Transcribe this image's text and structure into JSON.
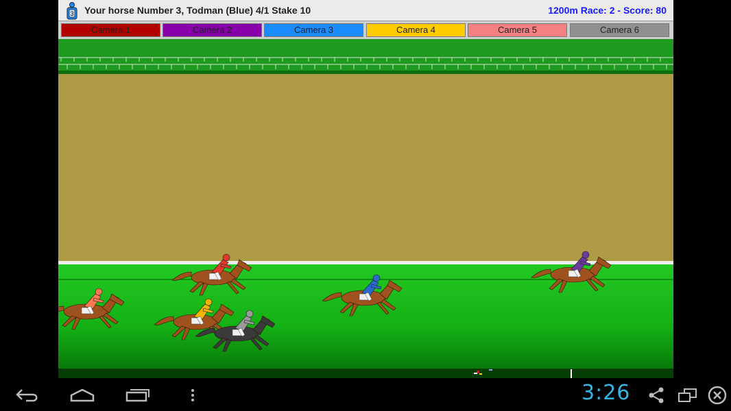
{
  "header": {
    "silk_number": "3",
    "horse_info": "Your horse Number 3, Todman (Blue) 4/1 Stake 10",
    "race_info": "1200m Race: 2 - Score: 80"
  },
  "cameras": [
    {
      "label": "Camera 1",
      "color": "#b20000"
    },
    {
      "label": "Camera 2",
      "color": "#8800aa"
    },
    {
      "label": "Camera 3",
      "color": "#1a8cff"
    },
    {
      "label": "Camera 4",
      "color": "#ffcc00"
    },
    {
      "label": "Camera 5",
      "color": "#f48080"
    },
    {
      "label": "Camera 6",
      "color": "#909090"
    }
  ],
  "track": {
    "sky_color": "#1e9a1e",
    "wall_color": "#ad9b45",
    "grass_color": "#1ec41e"
  },
  "horses": [
    {
      "jockey": "red",
      "silk_color": "#e23a2a",
      "coat": "#a0521e"
    },
    {
      "jockey": "orange",
      "silk_color": "#ff7a50",
      "coat": "#a0521e"
    },
    {
      "jockey": "yellow",
      "silk_color": "#f5b400",
      "coat": "#a0521e"
    },
    {
      "jockey": "gray",
      "silk_color": "#9a9a9a",
      "coat": "#3a3a3a"
    },
    {
      "jockey": "blue",
      "silk_color": "#2a6ad0",
      "coat": "#a0521e"
    },
    {
      "jockey": "purple",
      "silk_color": "#6a3aa0",
      "coat": "#a0521e"
    }
  ],
  "system_bar": {
    "clock": "3:26"
  }
}
